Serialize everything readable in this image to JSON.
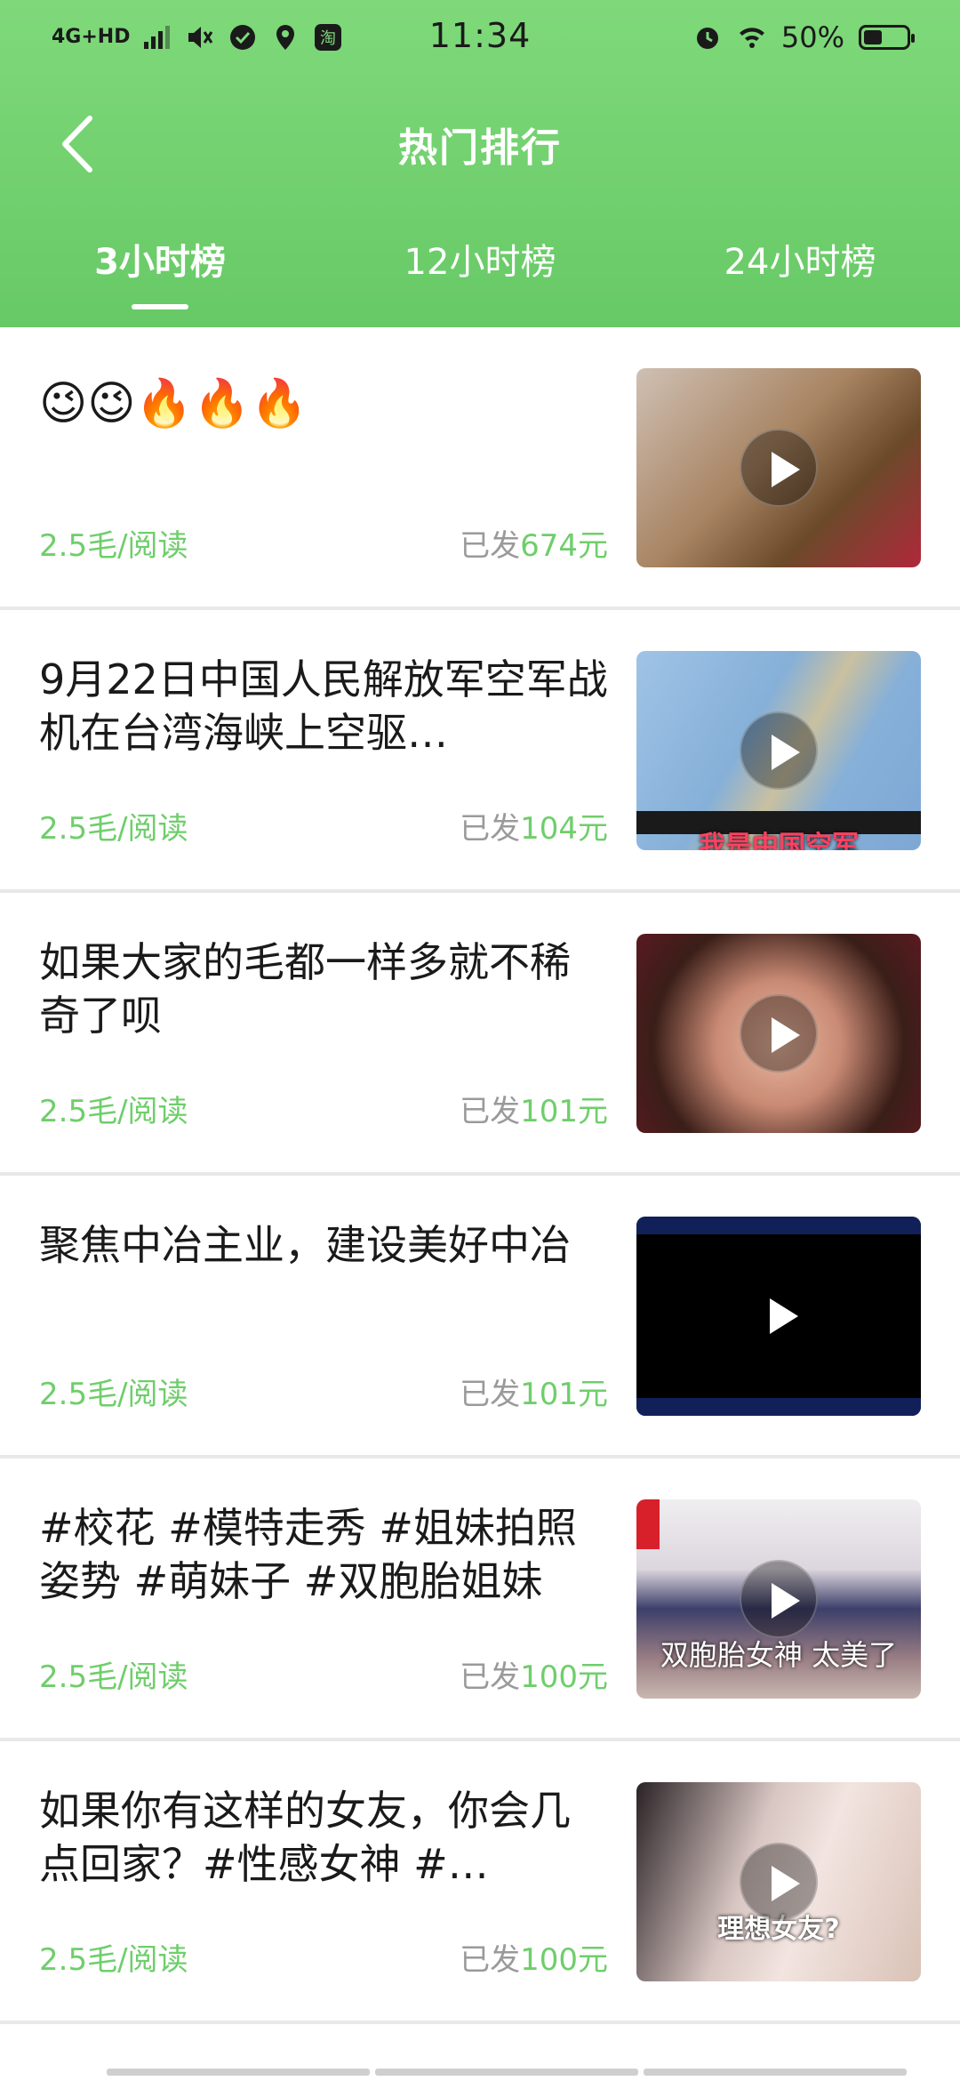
{
  "status_bar": {
    "network": "4G+HD",
    "time": "11:34",
    "battery": "50%",
    "battery_level": 0.5
  },
  "nav": {
    "title": "热门排行"
  },
  "tabs": [
    {
      "label": "3小时榜",
      "active": true
    },
    {
      "label": "12小时榜",
      "active": false
    },
    {
      "label": "24小时榜",
      "active": false
    }
  ],
  "items": [
    {
      "title": "😉😉🔥🔥🔥",
      "price": "2.5毛/阅读",
      "sent_prefix": "已发",
      "sent_amount": "674元",
      "caption": ""
    },
    {
      "title": "9月22日中国人民解放军空军战机在台湾海峡上空驱…",
      "price": "2.5毛/阅读",
      "sent_prefix": "已发",
      "sent_amount": "104元",
      "caption": "我是中国空军"
    },
    {
      "title": "如果大家的毛都一样多就不稀奇了呗",
      "price": "2.5毛/阅读",
      "sent_prefix": "已发",
      "sent_amount": "101元",
      "caption": ""
    },
    {
      "title": "聚焦中冶主业，建设美好中冶",
      "price": "2.5毛/阅读",
      "sent_prefix": "已发",
      "sent_amount": "101元",
      "caption": ""
    },
    {
      "title": "#校花 #模特走秀 #姐妹拍照姿势 #萌妹子 #双胞胎姐妹",
      "price": "2.5毛/阅读",
      "sent_prefix": "已发",
      "sent_amount": "100元",
      "caption": "双胞胎女神 太美了"
    },
    {
      "title": "如果你有这样的女友，你会几点回家？#性感女神 #…",
      "price": "2.5毛/阅读",
      "sent_prefix": "已发",
      "sent_amount": "100元",
      "caption": "理想女友?"
    }
  ],
  "colors": {
    "accent": "#6fce6b",
    "header_top": "#7fd97a",
    "header_bottom": "#67c966"
  }
}
